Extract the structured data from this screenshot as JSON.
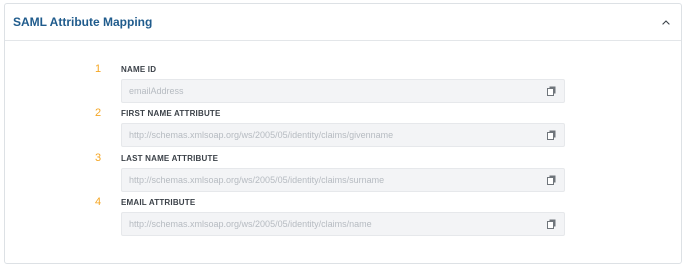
{
  "panel": {
    "title": "SAML Attribute Mapping",
    "icon": "chevron-up-icon"
  },
  "fields": [
    {
      "number": "1",
      "label": "NAME ID",
      "placeholder": "emailAddress"
    },
    {
      "number": "2",
      "label": "FIRST NAME ATTRIBUTE",
      "placeholder": "http://schemas.xmlsoap.org/ws/2005/05/identity/claims/givenname"
    },
    {
      "number": "3",
      "label": "LAST NAME ATTRIBUTE",
      "placeholder": "http://schemas.xmlsoap.org/ws/2005/05/identity/claims/surname"
    },
    {
      "number": "4",
      "label": "EMAIL ATTRIBUTE",
      "placeholder": "http://schemas.xmlsoap.org/ws/2005/05/identity/claims/name"
    }
  ],
  "colors": {
    "title": "#1f5b8c",
    "number": "#f5a623",
    "label": "#3b4148",
    "input_bg": "#f3f4f6",
    "placeholder": "#b6bbc1"
  }
}
